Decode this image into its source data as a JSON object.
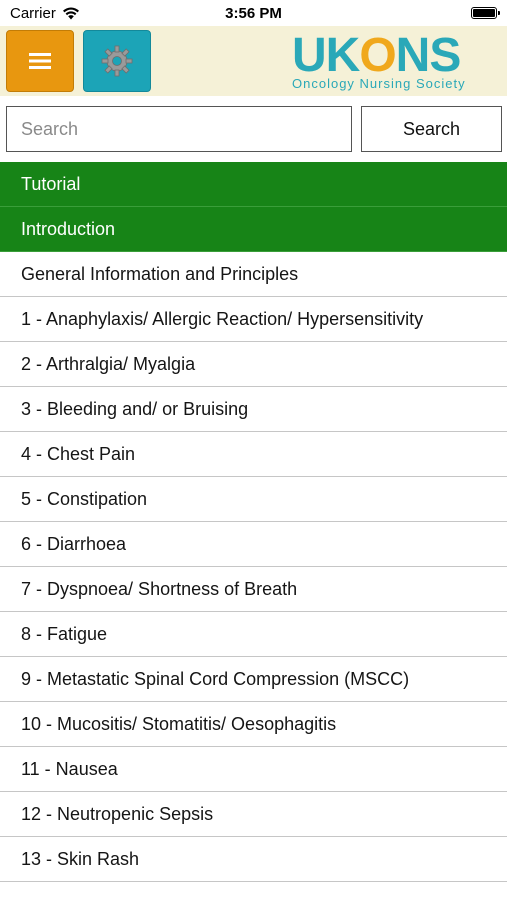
{
  "status_bar": {
    "carrier": "Carrier",
    "time": "3:56 PM"
  },
  "header": {
    "logo_text_uk": "UK",
    "logo_text_o": "O",
    "logo_text_ns": "NS",
    "logo_tagline": "Oncology Nursing Society",
    "menu_icon": "hamburger-icon",
    "settings_icon": "gear-icon"
  },
  "search": {
    "placeholder": "Search",
    "button_label": "Search"
  },
  "colors": {
    "menu_button": "#e8970f",
    "settings_button": "#1ca4b7",
    "highlight_row": "#178417",
    "header_bg": "#f5f1d7"
  },
  "list": {
    "items": [
      {
        "label": "Tutorial",
        "highlight": true
      },
      {
        "label": "Introduction",
        "highlight": true
      },
      {
        "label": "General Information and Principles"
      },
      {
        "label": "1 - Anaphylaxis/ Allergic Reaction/ Hypersensitivity"
      },
      {
        "label": "2 - Arthralgia/ Myalgia"
      },
      {
        "label": "3 - Bleeding and/ or Bruising"
      },
      {
        "label": "4 - Chest Pain"
      },
      {
        "label": "5 - Constipation"
      },
      {
        "label": "6 - Diarrhoea"
      },
      {
        "label": "7 - Dyspnoea/ Shortness of Breath"
      },
      {
        "label": "8 - Fatigue"
      },
      {
        "label": "9 - Metastatic Spinal Cord Compression (MSCC)"
      },
      {
        "label": "10 - Mucositis/ Stomatitis/ Oesophagitis"
      },
      {
        "label": "11 - Nausea"
      },
      {
        "label": "12 - Neutropenic Sepsis"
      },
      {
        "label": "13 - Skin Rash"
      }
    ]
  }
}
